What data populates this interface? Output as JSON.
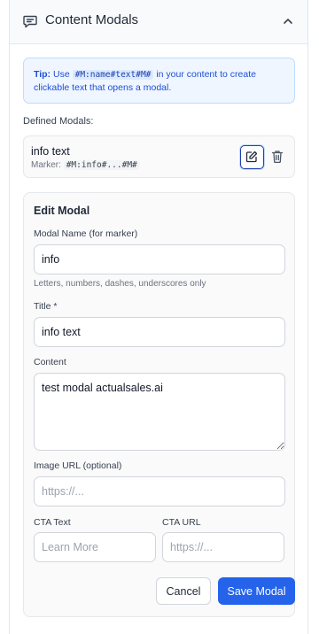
{
  "panel": {
    "title": "Content Modals",
    "icons": {
      "header": "message-square-icon",
      "collapse": "chevron-up-icon"
    }
  },
  "tip": {
    "label": "Tip:",
    "text_before": "Use",
    "code": "#M:name#text#M#",
    "text_after": "in your content to create clickable text that opens a modal."
  },
  "defined_modals": {
    "label": "Defined Modals:",
    "items": [
      {
        "title": "info text",
        "marker_label": "Marker:",
        "marker_code": "#M:info#...#M#",
        "icons": {
          "edit": "edit-icon",
          "delete": "trash-icon"
        }
      }
    ]
  },
  "edit_modal": {
    "title": "Edit Modal",
    "name": {
      "label": "Modal Name (for marker)",
      "value": "info",
      "hint": "Letters, numbers, dashes, underscores only"
    },
    "title_field": {
      "label": "Title *",
      "value": "info text"
    },
    "content": {
      "label": "Content",
      "value": "test modal actualsales.ai"
    },
    "image_url": {
      "label": "Image URL (optional)",
      "placeholder": "https://..."
    },
    "cta_text": {
      "label": "CTA Text",
      "placeholder": "Learn More"
    },
    "cta_url": {
      "label": "CTA URL",
      "placeholder": "https://..."
    },
    "cancel_label": "Cancel",
    "save_label": "Save Modal"
  },
  "colors": {
    "primary": "#2563eb",
    "tip_background": "#eff6ff",
    "tip_text": "#1d4ed8",
    "border": "#e5e7eb"
  }
}
